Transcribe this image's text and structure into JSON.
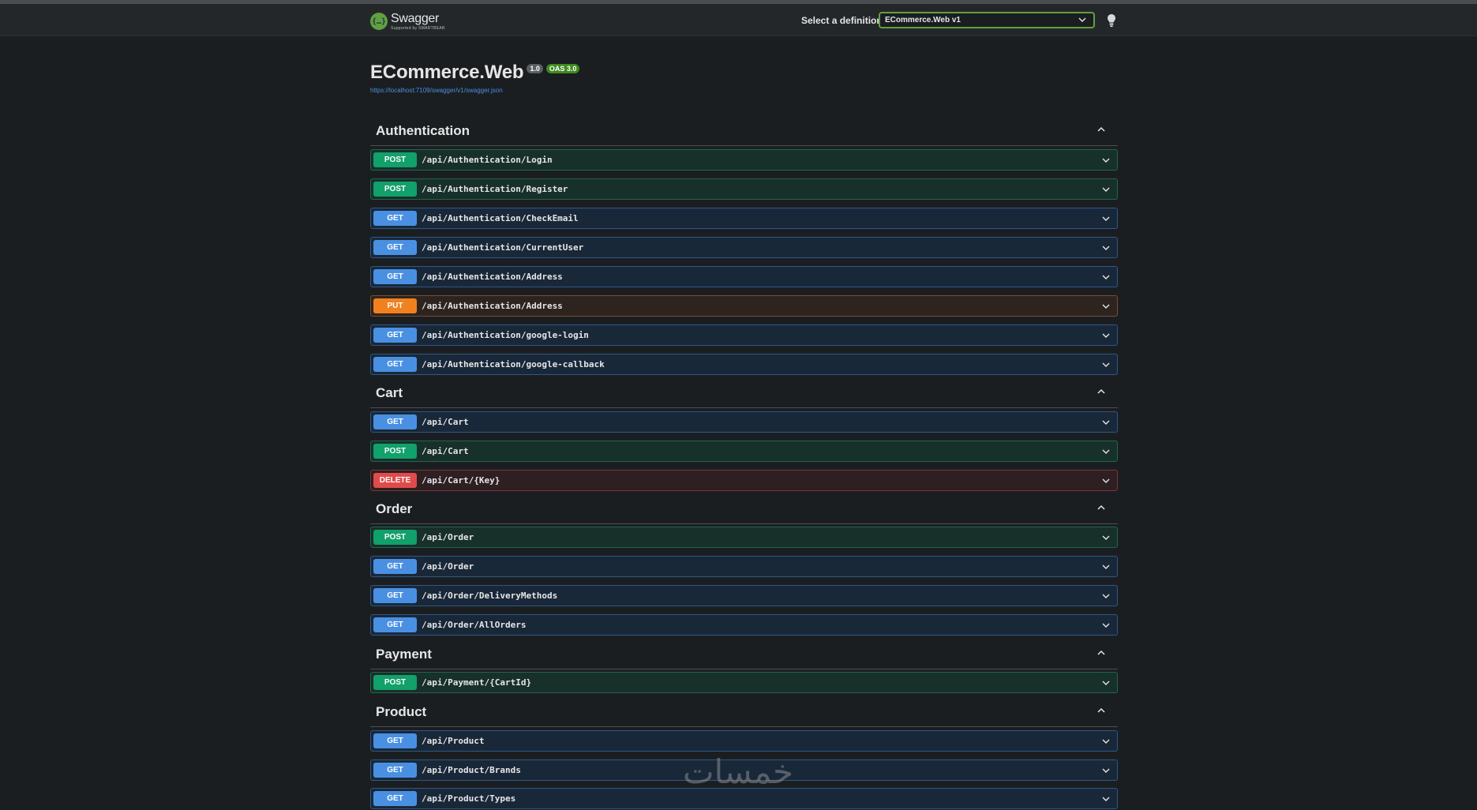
{
  "topbar": {
    "logo_name": "Swagger",
    "logo_sub": "Supported by SMARTBEAR",
    "definition_label": "Select a definition",
    "definition_value": "ECommerce.Web v1"
  },
  "info": {
    "title": "ECommerce.Web",
    "version": "1.0",
    "oas": "OAS 3.0",
    "spec_url": "https://localhost:7109/swagger/v1/swagger.json"
  },
  "tags": [
    {
      "name": "Authentication",
      "operations": [
        {
          "method": "POST",
          "path": "/api/Authentication/Login"
        },
        {
          "method": "POST",
          "path": "/api/Authentication/Register"
        },
        {
          "method": "GET",
          "path": "/api/Authentication/CheckEmail"
        },
        {
          "method": "GET",
          "path": "/api/Authentication/CurrentUser"
        },
        {
          "method": "GET",
          "path": "/api/Authentication/Address"
        },
        {
          "method": "PUT",
          "path": "/api/Authentication/Address"
        },
        {
          "method": "GET",
          "path": "/api/Authentication/google-login"
        },
        {
          "method": "GET",
          "path": "/api/Authentication/google-callback"
        }
      ]
    },
    {
      "name": "Cart",
      "operations": [
        {
          "method": "GET",
          "path": "/api/Cart"
        },
        {
          "method": "POST",
          "path": "/api/Cart"
        },
        {
          "method": "DELETE",
          "path": "/api/Cart/{Key}"
        }
      ]
    },
    {
      "name": "Order",
      "operations": [
        {
          "method": "POST",
          "path": "/api/Order"
        },
        {
          "method": "GET",
          "path": "/api/Order"
        },
        {
          "method": "GET",
          "path": "/api/Order/DeliveryMethods"
        },
        {
          "method": "GET",
          "path": "/api/Order/AllOrders"
        }
      ]
    },
    {
      "name": "Payment",
      "operations": [
        {
          "method": "POST",
          "path": "/api/Payment/{CartId}"
        }
      ]
    },
    {
      "name": "Product",
      "operations": [
        {
          "method": "GET",
          "path": "/api/Product"
        },
        {
          "method": "GET",
          "path": "/api/Product/Brands"
        },
        {
          "method": "GET",
          "path": "/api/Product/Types"
        }
      ]
    }
  ],
  "colors": {
    "POST": "#12a06b",
    "GET": "#4a90e2",
    "PUT": "#f0811e",
    "DELETE": "#e04b4b",
    "accent": "#62a03f"
  },
  "watermark": "خمسات"
}
